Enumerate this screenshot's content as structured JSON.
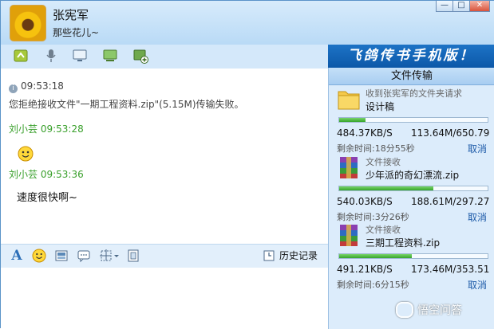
{
  "header": {
    "contact_name": "张宪军",
    "status_message": "那些花儿~",
    "window_buttons": [
      "—",
      "□",
      "✕"
    ]
  },
  "toolbar": {
    "items": [
      "file-transfer-icon",
      "microphone-icon",
      "monitor-icon",
      "remote-desktop-icon",
      "add-app-icon"
    ]
  },
  "banner": {
    "text": "飞鸽传书手机版！"
  },
  "chat": {
    "system_time": "09:53:18",
    "system_message": "您拒绝接收文件\"一期工程资料.zip\"(5.15M)传输失败。",
    "messages": [
      {
        "sender": "刘小芸",
        "time": "09:53:28",
        "content_type": "emoji"
      },
      {
        "sender": "刘小芸",
        "time": "09:53:36",
        "text": "速度很快啊~"
      }
    ]
  },
  "format_bar": {
    "history_label": "历史记录"
  },
  "transfers": {
    "title": "文件传输",
    "items": [
      {
        "subtitle": "收到张宪军的文件夹请求",
        "name": "设计稿",
        "icon": "folder-icon",
        "progress": 0.175,
        "speed": "484.37KB/S",
        "size": "113.64M/650.79",
        "remaining": "剩余时间:18分55秒",
        "cancel": "取消"
      },
      {
        "subtitle": "文件接收",
        "name": "少年派的奇幻漂流.zip",
        "icon": "archive-icon",
        "progress": 0.634,
        "speed": "540.03KB/S",
        "size": "188.61M/297.27",
        "remaining": "剩余时间:3分26秒",
        "cancel": "取消"
      },
      {
        "subtitle": "文件接收",
        "name": "三期工程资料.zip",
        "icon": "archive-icon",
        "progress": 0.49,
        "speed": "491.21KB/S",
        "size": "173.46M/353.51",
        "remaining": "剩余时间:6分15秒",
        "cancel": "取消"
      }
    ]
  },
  "watermark": {
    "text": "悟空问答"
  },
  "colors": {
    "accent": "#1d73c6",
    "sender": "#3aa02c",
    "progress": "#35a52a",
    "link": "#1d5aa8"
  }
}
